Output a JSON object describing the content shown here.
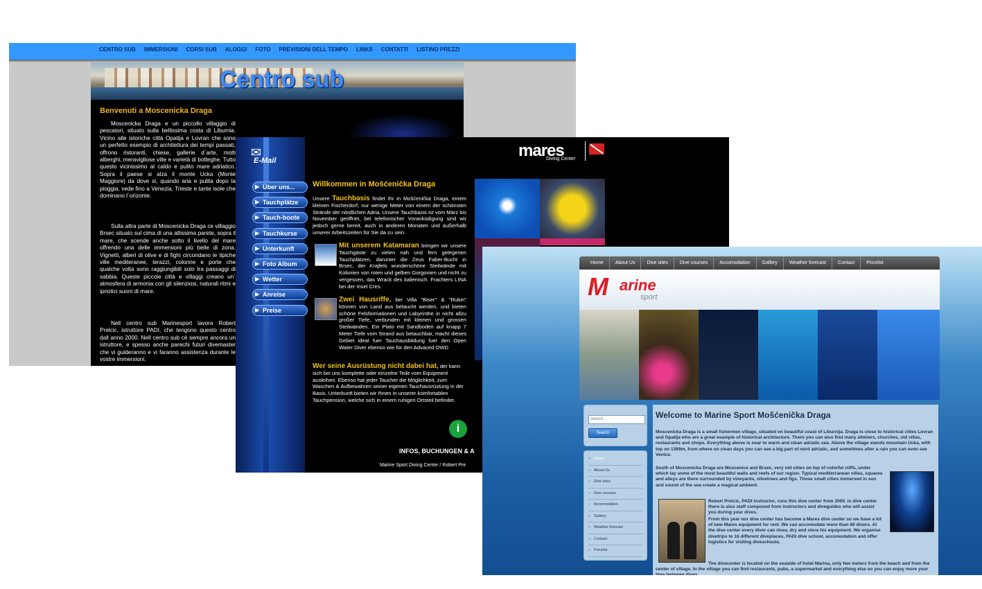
{
  "site_it": {
    "nav": [
      "CENTRO SUB",
      "IMMERSIONI",
      "CORSI SUB",
      "ALOGGI",
      "FOTO",
      "PREVISIONI DELL TEMPO",
      "LINKS",
      "CONTATTI",
      "LISTINO PREZZI"
    ],
    "banner_title": "Centro sub",
    "heading": "Benvenuti a Moscenicka Draga",
    "p1": "Moscenicka Draga e un piccollo villaggio di pescatori, situato sulla bellissima costa di Liburnia. Vicino alle istoriche città Opatija e Lovran che sono un perfetto esempio di architettura dei tempi passati, offrono ristoranti, chiese, gallerie d´arte, molti alberghi, meravigliose ville e varietà di botteghe. Tutto questo vicinissimo al caldo e pulito mare adriatico. Sopra il paese si alza il monte Ucka (Monte Maggiore) da dove si, quando aria e pulita dopo la pioggia, vede fino a Venezia, Trieste e tante isole che dominano l´orizonte.",
    "p2": "Sulla altra parte di Moscenicka Draga ce villaggio Brsec situato sul cima di una altissima parete, sopra il mare, che scende anche sotto il livello del mare offrendo una delle immersioni più belle di zona. Vignetti, alberi di olive e di fighi circondano le tipiche ville mediteranee, terazzi, colonne e porte che qualche volta sono raggiungibili solo tra passaggi di sabbia. Queste piccole città e villaggi creano un´ atmosfera di armonia con gli silenziosi, naturali ritmi e ipnotici suoni di mare.",
    "p3": "Nell centro sub Marinesport lavora Robert Prelcic, istruttore PADI, che tengono questo centro dall anno 2000. Nell centro sub cè sempre ancora un istruttore, e spesso anche parechi futuri divemaster che vi guideranno e vi faranno assistenza durante le vostre immersioni."
  },
  "site_de": {
    "email_label": "E-Mail",
    "nav": [
      "Über uns...",
      "Tauchplätze",
      "Tauch-boote",
      "Tauchkurse",
      "Unterkunft",
      "Foto Album",
      "Wetter",
      "Anreise",
      "Preise"
    ],
    "logo": "mares",
    "logo_sub": "Diving Center",
    "heading": "Willkommen in Mošćenička Draga",
    "p1_lead": "Unsere",
    "p1_bold": "Tauchbasis",
    "p1": "findet Ihr in Mošćenička Draga, einem kleinen Fischerdorf, nur wenige Meter von einem der schönsten Strände der nördlichen Adria. Unsere Tauchbasis ist vom März bis November geöffnet, bei telefonischer Voranküdigung sind wir jedoch gerne bereit, auch in anderen Monaten und außerhalb unserer Arbeitszeiten für Sie da zu sein.",
    "p2_bold": "Mit unserem Katamaran",
    "p2": "bringen wir unsere Tauchgäste zu vielen nah und fern gelegenen Tauchplätzen, darunter die Zeus Faber-Bucht in Brsec, der Krajfels wunderschöne Steilwände mit Kolonien von roten und gelben Gorgonien und nicht zu vergessen, das Wrack des italienisch. Frachters LINA bei der Insel Cres.",
    "p3_bold": "Zwei Hausriffe,",
    "p3": "bei Villa \"Biser\" & \"Rubin\" können von Land aus betaucht werden, und bieten schöne Felsformationen und Labyrinthe in nicht allzu großer Tiefe, verbunden mit kleinen und grossen Steilwänden. Ein Plato mit Sandboden auf knapp 7 Meter Tiefe vom Strand aus betauchbar, macht dieses Gebiet ideal fuer Tauchausbildung fuer den Open Water Diver ebenso wie für den Advaced OWD",
    "p4_bold": "Wer seine Ausrüstung nicht dabei hat,",
    "p4": "der kann sich bei uns komplette oder einzelne Teile vom Equipment ausleihen. Ebenso hat jeder Taucher die Möglichkeit, zum Waschen & Aufbewahren seiner eigenen Tauchausrüstung in der Basis. Unterkunft bieten wir Ihnen in unserer komfortablen Tauchpension, welche sich in einem ruhigen Ortsteil befindet.",
    "info_title": "INFOS, BUCHUNGEN & A",
    "footer": "Marine Sport Diving Center / Robert Pre"
  },
  "site_en": {
    "nav": [
      "Home",
      "About Us",
      "Dive sites",
      "Dive courses",
      "Accomodation",
      "Gallery",
      "Weather forecast",
      "Contact",
      "Pricelist"
    ],
    "logo_m": "M",
    "logo_rest": "arine",
    "logo_sport": "sport",
    "search_placeholder": "search...",
    "search_button": "Search",
    "side_menu": [
      "Home",
      "About Us",
      "Dive sites",
      "Dive courses",
      "Accomodation",
      "Gallery",
      "Weather forecast",
      "Contact",
      "Pricelist"
    ],
    "heading": "Welcome to Marine Sport Mošćenička Draga",
    "p1": "Moscenicka Draga is a small fishermen village, situated on beautiful coast of Liburnija. Draga is close to historical cities Lovran and Opatija who are a great example of historical architecture. There you can also find many atteliers, churches, old villas, restaurants and shops. Everything above is near to warm and clean adriatic sea. Above the village stands mountain Ucka, with top on 1399m, from where on clean days you can see a big part of nord adriatic, and sometimes after a rain you can even see Venice.",
    "p2": "South of Moscenicka Draga are Moscenice and Brsec, very old cities on top of colorful cliffs, under which lay some of the most beautiful walls and reefs of our region. Typical mediterranean villas, squares and alleys are there surrounded by vineyards, olivetrees and figs. Those small cities immersed in sun and sound of the sea create a magical ambient.",
    "p3": "Robert Prelcic, PADI instructor, runs this dive center from 2000. in dive center there is also staff composed from instructors and diveguides who will assist you during your dives.",
    "p4": "From this year our dive center has become a Mares dive center so we have a lot of new Mares equipment for rent. We can accomodate more than 60 divers. At the dive center every diver can rinse, dry and store his equipment. We organise divetrips to 16 different diveplaces, PADI dive school, accomodation and offer logistics for visiting diveschools.",
    "p5": "The divecenter is located on the seaside of hotel Marina, only few meters from the beach and from the center of village. In the village you can find restaurants, pubs, a supermarket and everything else so you can enjoy more your time between dives."
  }
}
